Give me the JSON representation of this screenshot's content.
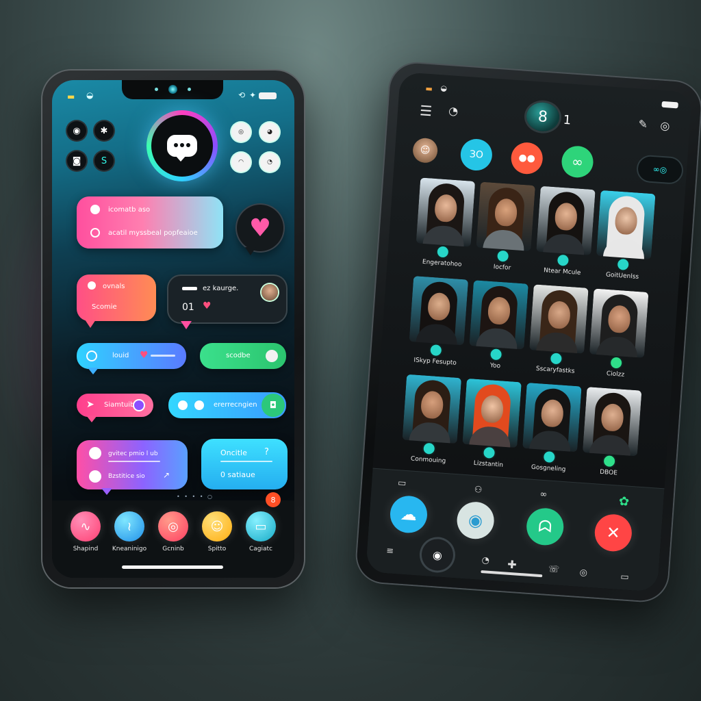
{
  "left_phone": {
    "main_chat_icon": "speech-bubble-icon",
    "top_buttons": [
      {
        "name": "aperture-icon",
        "glyph": "◉"
      },
      {
        "name": "settings-icon",
        "glyph": "✱"
      },
      {
        "name": "bubble-icon",
        "glyph": "◙"
      },
      {
        "name": "s-logo-icon",
        "glyph": "S"
      },
      {
        "name": "camera-icon",
        "glyph": "◎"
      },
      {
        "name": "face-icon",
        "glyph": "◕"
      },
      {
        "name": "chat-icon",
        "glyph": "◠"
      },
      {
        "name": "swirl-icon",
        "glyph": "◔"
      }
    ],
    "bubbles": {
      "b1_line1": "icomatb  aso",
      "b1_line2": "acatil  myssbeal  popfeaioe",
      "b2_line1": "ovnals",
      "b2_line2": "Scomie",
      "b3_line1": "ez kaurge.",
      "b3_line2": "01",
      "b4": "louid",
      "b5": "scodbe",
      "b6": "Siamtuib",
      "b7": "ererrecngien",
      "b8_line1": "gvitec pmio l ub",
      "b8_line2": "Bzstitice  sio",
      "b9_line1": "Oncitle",
      "b9_q": "?",
      "b9_line2": "0  satiaue"
    },
    "page_dots": "• • • • ○",
    "notification_badge": "8",
    "tabs": [
      {
        "label": "Shapind",
        "icon": "squiggle-icon",
        "glyph": "∿",
        "color": "#ff4f8e"
      },
      {
        "label": "Kneaninigo",
        "icon": "wave-icon",
        "glyph": "≀",
        "color": "#27b6ff"
      },
      {
        "label": "Gcninb",
        "icon": "target-icon",
        "glyph": "◎",
        "color": "#ff4d6d"
      },
      {
        "label": "Spitto",
        "icon": "person-icon",
        "glyph": "☺",
        "color": "#ffc226"
      },
      {
        "label": "Cagiatc",
        "icon": "laptop-icon",
        "glyph": "▭",
        "color": "#28c8e0"
      }
    ]
  },
  "right_phone": {
    "badge_value": "8",
    "badge_suffix": "1",
    "top_row": [
      {
        "name": "avatar",
        "glyph": "☺",
        "color": "#6a4a2f"
      },
      {
        "name": "ko-button",
        "glyph": "ЗО",
        "color": "#25c5e6"
      },
      {
        "name": "group-button",
        "glyph": "●●",
        "color": "#ff5a3d"
      },
      {
        "name": "infinity-button",
        "glyph": "∞",
        "color": "#2ed47a"
      }
    ],
    "top_pill": "∞◎",
    "contacts": [
      {
        "name": "Engeratohoo",
        "hair": "#1b1614",
        "skin": "#e8b99a",
        "bg": "#d8e4ec",
        "shirt": "#33383c"
      },
      {
        "name": "Iocfor",
        "hair": "#3a2416",
        "skin": "#d9a27c",
        "bg": "#5c4a3a",
        "shirt": "#6a7276"
      },
      {
        "name": "Ntear Mcule",
        "hair": "#151210",
        "skin": "#e4b493",
        "bg": "#cfd8dd",
        "shirt": "#2a2f33"
      },
      {
        "name": "GoitUenlss",
        "hair": "#e8e8e8",
        "skin": "#ecc6aa",
        "bg": "#3ad0ea",
        "shirt": "#e7e7e7"
      },
      {
        "name": "ISkyp Fesupto",
        "hair": "#141110",
        "skin": "#dcae8c",
        "bg": "#2e8ea8",
        "shirt": "#1c1f22"
      },
      {
        "name": "Yoo",
        "hair": "#1d1512",
        "skin": "#d3a07c",
        "bg": "#1c8aa3",
        "shirt": "#30363a"
      },
      {
        "name": "Sscaryfastks",
        "hair": "#3a2618",
        "skin": "#d8a888",
        "bg": "#e4e6e4",
        "shirt": "#2b2b2b"
      },
      {
        "name": "Ciolzz",
        "hair": "#1e1e1e",
        "skin": "#d8a180",
        "bg": "#f3f3f3",
        "shirt": "#26292b"
      },
      {
        "name": "Conmouing",
        "hair": "#2b1d14",
        "skin": "#d69f7c",
        "bg": "#2fb3cf",
        "shirt": "#33383b"
      },
      {
        "name": "Lizstantin",
        "hair": "#e24a1e",
        "skin": "#f0c4a4",
        "bg": "#2cc3d8",
        "shirt": "#4a4040"
      },
      {
        "name": "Gosgneling",
        "hair": "#141414",
        "skin": "#e2b293",
        "bg": "#25a8c8",
        "shirt": "#262b2e"
      },
      {
        "name": "DBOE",
        "hair": "#1a1512",
        "skin": "#deb091",
        "bg": "#e9ecee",
        "shirt": "#2a2d30"
      }
    ],
    "actions": [
      {
        "name": "cloud-button",
        "glyph": "☁",
        "color": "#28b7f0"
      },
      {
        "name": "camera-button",
        "glyph": "◉",
        "color": "#d8e4e2"
      },
      {
        "name": "voice-button",
        "glyph": "ᗣ",
        "color": "#24c989"
      },
      {
        "name": "end-call-button",
        "glyph": "✕",
        "color": "#ff4545"
      }
    ]
  }
}
